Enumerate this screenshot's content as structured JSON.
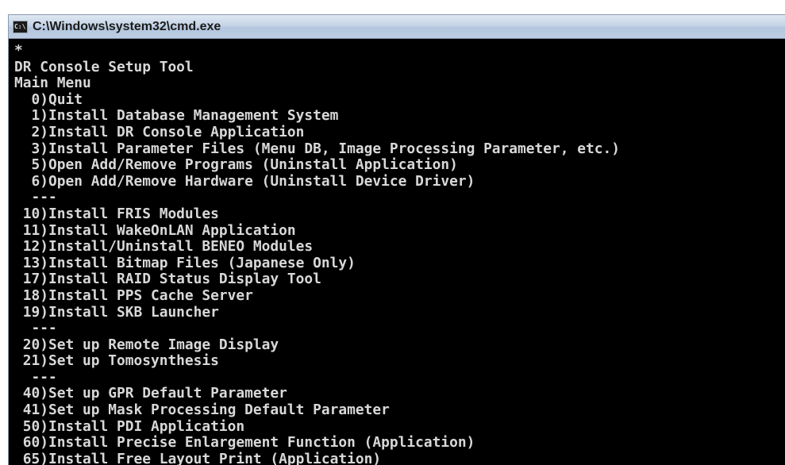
{
  "window": {
    "title": "C:\\Windows\\system32\\cmd.exe",
    "icon": "cmd-icon",
    "icon_text": "C:\\"
  },
  "console": {
    "lines": [
      "*",
      "DR Console Setup Tool",
      "Main Menu",
      "  0)Quit",
      "  1)Install Database Management System",
      "  2)Install DR Console Application",
      "  3)Install Parameter Files (Menu DB, Image Processing Parameter, etc.)",
      "  5)Open Add/Remove Programs (Uninstall Application)",
      "  6)Open Add/Remove Hardware (Uninstall Device Driver)",
      "  ---",
      " 10)Install FRIS Modules",
      " 11)Install WakeOnLAN Application",
      " 12)Install/Uninstall BENEO Modules",
      " 13)Install Bitmap Files (Japanese Only)",
      " 17)Install RAID Status Display Tool",
      " 18)Install PPS Cache Server",
      " 19)Install SKB Launcher",
      "  ---",
      " 20)Set up Remote Image Display",
      " 21)Set up Tomosynthesis",
      "  ---",
      " 40)Set up GPR Default Parameter",
      " 41)Set up Mask Processing Default Parameter",
      " 50)Install PDI Application",
      " 60)Install Precise Enlargement Function (Application)",
      " 65)Install Free Layout Print (Application)"
    ]
  },
  "colors": {
    "console_background": "#000000",
    "console_text": "#d8d8d8",
    "titlebar": "#c5d4e6"
  }
}
